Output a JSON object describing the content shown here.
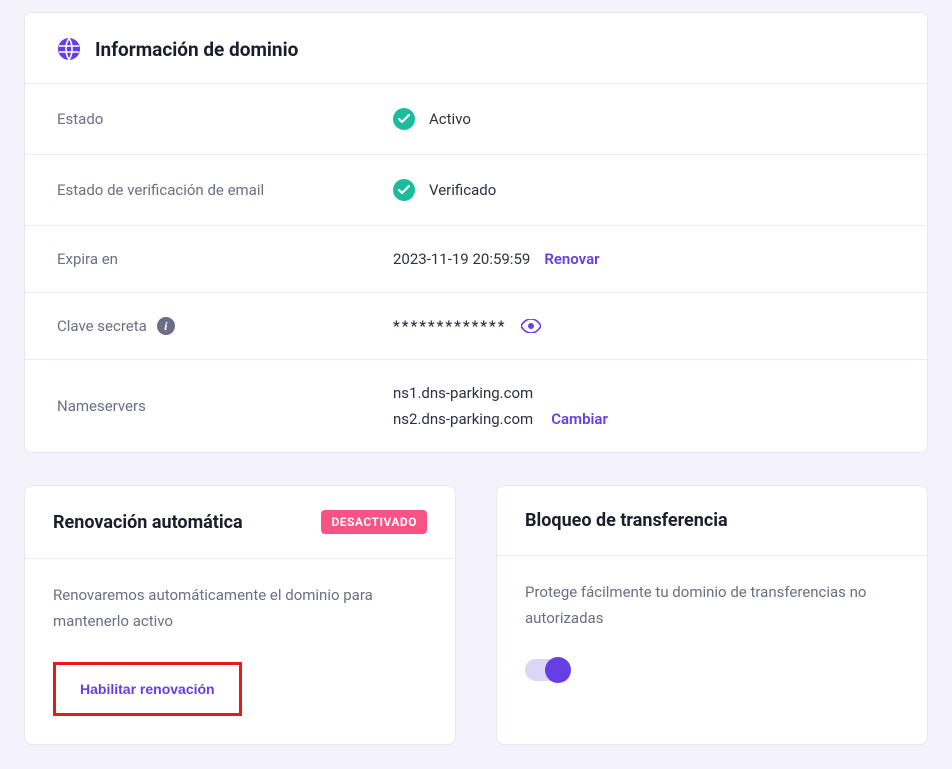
{
  "domainInfo": {
    "title": "Información de dominio",
    "rows": {
      "status": {
        "label": "Estado",
        "value": "Activo"
      },
      "emailVerification": {
        "label": "Estado de verificación de email",
        "value": "Verificado"
      },
      "expires": {
        "label": "Expira en",
        "value": "2023-11-19 20:59:59",
        "action": "Renovar"
      },
      "secret": {
        "label": "Clave secreta",
        "value": "*************"
      },
      "nameservers": {
        "label": "Nameservers",
        "ns1": "ns1.dns-parking.com",
        "ns2": "ns2.dns-parking.com",
        "action": "Cambiar"
      }
    }
  },
  "autoRenew": {
    "title": "Renovación automática",
    "badge": "DESACTIVADO",
    "description": "Renovaremos automáticamente el dominio para mantenerlo activo",
    "button": "Habilitar renovación"
  },
  "transferLock": {
    "title": "Bloqueo de transferencia",
    "description": "Protege fácilmente tu dominio de transferencias no autorizadas"
  }
}
